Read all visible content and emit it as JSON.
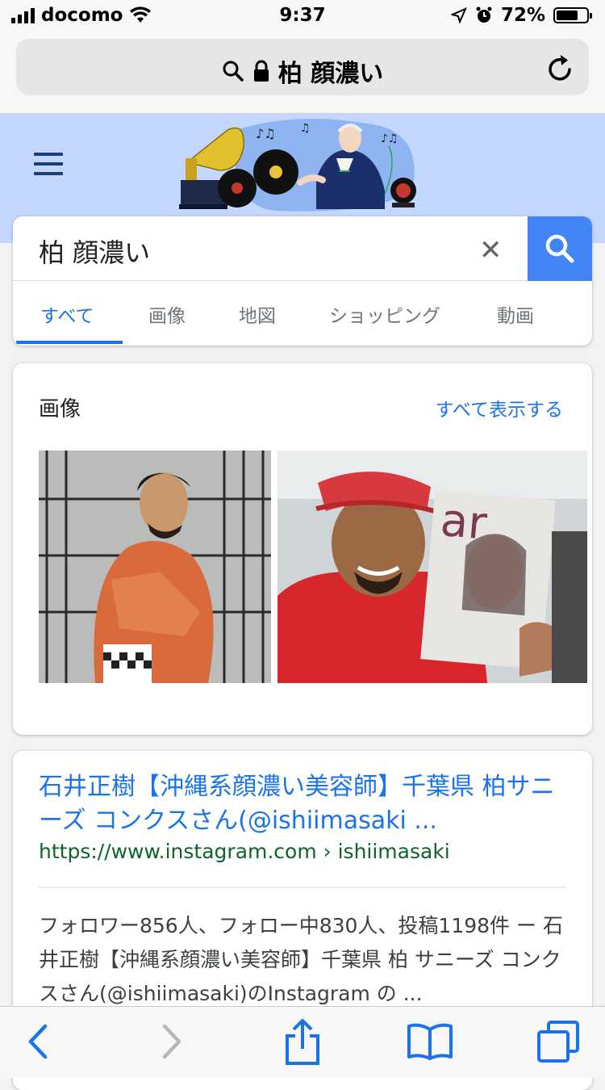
{
  "status_bar": {
    "carrier": "docomo",
    "time": "9:37",
    "battery": "72%",
    "battery_level": 0.72
  },
  "browser": {
    "url_title": "柏 顔濃い",
    "icons": [
      "search-icon",
      "lock-icon",
      "reload-icon"
    ]
  },
  "search": {
    "query": "柏 顔濃い",
    "tabs": [
      {
        "label": "すべて",
        "active": true
      },
      {
        "label": "画像",
        "active": false
      },
      {
        "label": "地図",
        "active": false
      },
      {
        "label": "ショッピング",
        "active": false
      },
      {
        "label": "動画",
        "active": false
      }
    ],
    "accent_color": "#4285f4"
  },
  "images_section": {
    "title": "画像",
    "show_all": "すべて表示する",
    "magazine_text": "ar"
  },
  "result": {
    "title": "石井正樹【沖縄系顔濃い美容師】千葉県 柏サニーズ コンクスさん(@ishiimasaki ...",
    "url": "https://www.instagram.com › ishiimasaki",
    "snippet": "フォロワー856人、フォロー中830人、投稿1198件 ー 石井正樹【沖縄系顔濃い美容師】千葉県 柏 サニーズ コンクスさん(@ishiimasaki)のInstagram の ..."
  },
  "toolbar": {
    "icons": [
      "back-icon",
      "forward-icon",
      "share-icon",
      "bookmarks-icon",
      "tabs-icon"
    ]
  }
}
